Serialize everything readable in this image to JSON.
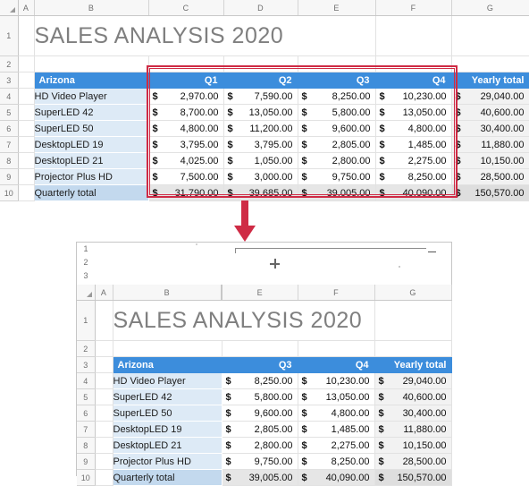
{
  "top_sheet": {
    "column_headers": [
      "A",
      "B",
      "C",
      "D",
      "E",
      "F",
      "G"
    ],
    "row_headers": [
      "1",
      "2",
      "3",
      "4",
      "5",
      "6",
      "7",
      "8",
      "9",
      "10"
    ],
    "title": "SALES ANALYSIS 2020",
    "table": {
      "header": [
        "Arizona",
        "Q1",
        "Q2",
        "Q3",
        "Q4",
        "Yearly total"
      ],
      "currency_symbol": "$",
      "rows": [
        {
          "label": "HD Video Player",
          "q1": "2,970.00",
          "q2": "7,590.00",
          "q3": "8,250.00",
          "q4": "10,230.00",
          "yearly": "29,040.00"
        },
        {
          "label": "SuperLED 42",
          "q1": "8,700.00",
          "q2": "13,050.00",
          "q3": "5,800.00",
          "q4": "13,050.00",
          "yearly": "40,600.00"
        },
        {
          "label": "SuperLED 50",
          "q1": "4,800.00",
          "q2": "11,200.00",
          "q3": "9,600.00",
          "q4": "4,800.00",
          "yearly": "30,400.00"
        },
        {
          "label": "DesktopLED 19",
          "q1": "3,795.00",
          "q2": "3,795.00",
          "q3": "2,805.00",
          "q4": "1,485.00",
          "yearly": "11,880.00"
        },
        {
          "label": "DesktopLED 21",
          "q1": "4,025.00",
          "q2": "1,050.00",
          "q3": "2,800.00",
          "q4": "2,275.00",
          "yearly": "10,150.00"
        },
        {
          "label": "Projector Plus HD",
          "q1": "7,500.00",
          "q2": "3,000.00",
          "q3": "9,750.00",
          "q4": "8,250.00",
          "yearly": "28,500.00"
        },
        {
          "label": "Quarterly total",
          "q1": "31,790.00",
          "q2": "39,685.00",
          "q3": "39,005.00",
          "q4": "40,090.00",
          "yearly": "150,570.00"
        }
      ]
    },
    "selection_highlight_color": "#cf2b45"
  },
  "arrow": {
    "direction": "down",
    "color": "#cf2b45"
  },
  "bottom_sheet": {
    "outline_levels": [
      "1",
      "2",
      "3"
    ],
    "group_collapse_label": "−",
    "group_expand_label": "+",
    "column_headers": [
      "A",
      "B",
      "E",
      "F",
      "G"
    ],
    "row_headers": [
      "1",
      "2",
      "3",
      "4",
      "5",
      "6",
      "7",
      "8",
      "9",
      "10"
    ],
    "title": "SALES ANALYSIS 2020",
    "table": {
      "header": [
        "Arizona",
        "Q3",
        "Q4",
        "Yearly total"
      ],
      "currency_symbol": "$",
      "rows": [
        {
          "label": "HD Video Player",
          "q3": "8,250.00",
          "q4": "10,230.00",
          "yearly": "29,040.00"
        },
        {
          "label": "SuperLED 42",
          "q3": "5,800.00",
          "q4": "13,050.00",
          "yearly": "40,600.00"
        },
        {
          "label": "SuperLED 50",
          "q3": "9,600.00",
          "q4": "4,800.00",
          "yearly": "30,400.00"
        },
        {
          "label": "DesktopLED 19",
          "q3": "2,805.00",
          "q4": "1,485.00",
          "yearly": "11,880.00"
        },
        {
          "label": "DesktopLED 21",
          "q3": "2,800.00",
          "q4": "2,275.00",
          "yearly": "10,150.00"
        },
        {
          "label": "Projector Plus HD",
          "q3": "9,750.00",
          "q4": "8,250.00",
          "yearly": "28,500.00"
        },
        {
          "label": "Quarterly total",
          "q3": "39,005.00",
          "q4": "40,090.00",
          "yearly": "150,570.00"
        }
      ]
    }
  },
  "theme": {
    "header_blue": "#3c8ddc",
    "label_blue": "#ddeaf6",
    "total_blue": "#c3d9ee",
    "title_gray": "#7f7f7f",
    "accent_red": "#cf2b45"
  }
}
